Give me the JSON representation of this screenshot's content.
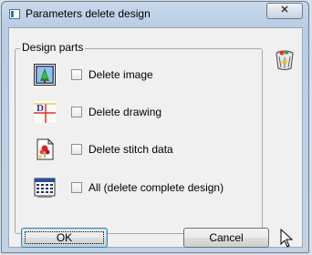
{
  "window": {
    "title": "Parameters delete design",
    "close_label": "✕"
  },
  "group": {
    "label": "Design parts",
    "options": [
      {
        "label": "Delete image",
        "checked": false,
        "icon": "image-icon"
      },
      {
        "label": "Delete drawing",
        "checked": false,
        "icon": "drawing-icon"
      },
      {
        "label": "Delete stitch data",
        "checked": false,
        "icon": "stitch-data-icon"
      },
      {
        "label": "All (delete complete design)",
        "checked": false,
        "icon": "complete-design-icon"
      }
    ]
  },
  "buttons": {
    "ok_label": "OK",
    "cancel_label": "Cancel"
  },
  "icons": {
    "trash": "recycle-bin-icon",
    "pointer": "mouse-cursor-icon"
  },
  "colors": {
    "titlebar": "#c4d6ea",
    "dialog_bg": "#f0f0f0"
  }
}
